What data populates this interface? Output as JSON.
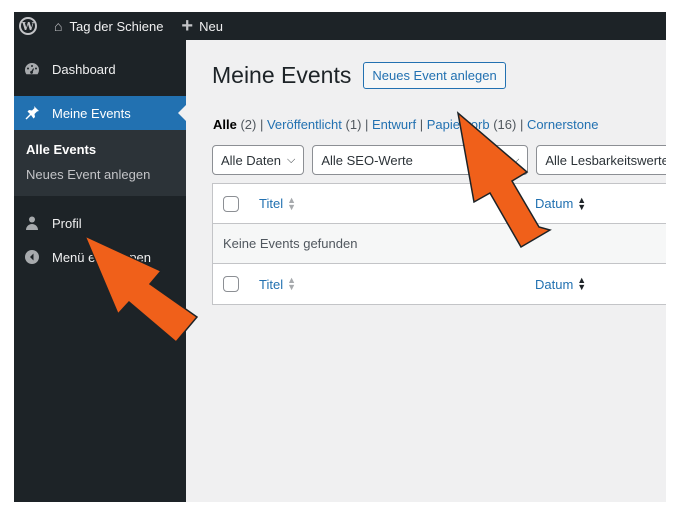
{
  "adminbar": {
    "site_name": "Tag der Schiene",
    "new_label": "Neu"
  },
  "sidebar": {
    "items": [
      {
        "label": "Dashboard",
        "icon": "dashboard-icon"
      },
      {
        "label": "Meine Events",
        "icon": "pin-icon",
        "current": true
      },
      {
        "label": "Profil",
        "icon": "user-icon"
      },
      {
        "label": "Menü einklappen",
        "icon": "collapse-icon"
      }
    ],
    "submenu": [
      {
        "label": "Alle Events",
        "current": true
      },
      {
        "label": "Neues Event anlegen"
      }
    ]
  },
  "main": {
    "title": "Meine Events",
    "add_new_label": "Neues Event anlegen",
    "views": {
      "all": "Alle",
      "all_count": "(2)",
      "published": "Veröffentlicht",
      "published_count": "(1)",
      "draft": "Entwurf",
      "trash": "Papierkorb",
      "trash_count": "(16)",
      "cornerstone": "Cornerstone"
    },
    "filters": {
      "dates": "Alle Daten",
      "seo": "Alle SEO-Werte",
      "readability": "Alle Lesbarkeitswerte"
    },
    "table": {
      "col_title": "Titel",
      "col_date": "Datum",
      "empty": "Keine Events gefunden"
    }
  },
  "colors": {
    "admin_dark": "#1d2327",
    "accent": "#2271b1",
    "arrow": "#f0601a"
  }
}
